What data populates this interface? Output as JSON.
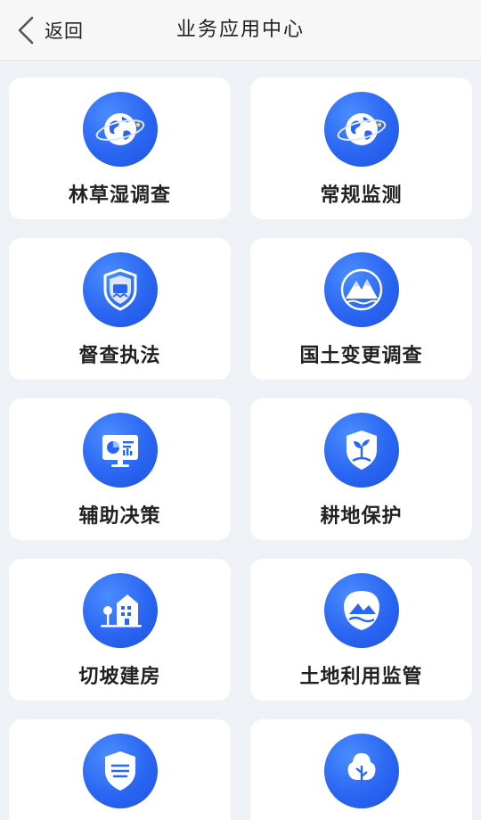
{
  "header": {
    "back_label": "返回",
    "title": "业务应用中心"
  },
  "apps": [
    {
      "label": "林草湿调查",
      "icon": "globe-orbit-icon"
    },
    {
      "label": "常规监测",
      "icon": "globe-orbit-icon"
    },
    {
      "label": "督查执法",
      "icon": "shield-badge-icon"
    },
    {
      "label": "国土变更调查",
      "icon": "mountain-icon"
    },
    {
      "label": "辅助决策",
      "icon": "monitor-chart-icon"
    },
    {
      "label": "耕地保护",
      "icon": "shield-sprout-icon"
    },
    {
      "label": "切坡建房",
      "icon": "building-icon"
    },
    {
      "label": "土地利用监管",
      "icon": "landscape-badge-icon"
    },
    {
      "label": "",
      "icon": "shield-wheat-icon"
    },
    {
      "label": "",
      "icon": "tree-icon"
    }
  ],
  "colors": {
    "accent": "#2a66f2",
    "background": "#eef1f5",
    "card": "#ffffff"
  }
}
